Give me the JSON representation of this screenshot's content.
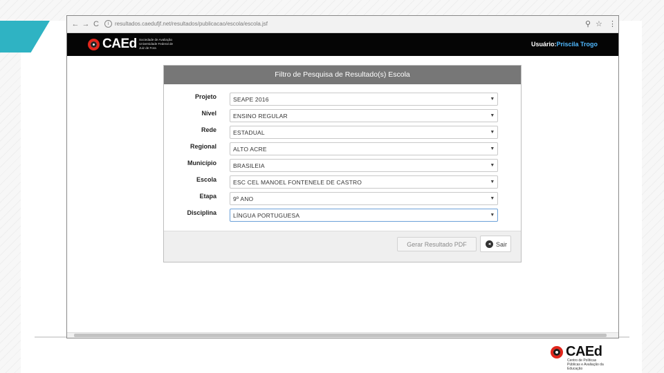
{
  "browser": {
    "url": "resultados.caedufjf.net/resultados/publicacao/escola/escola.jsf",
    "nav_back": "←",
    "nav_forward": "→",
    "nav_reload": "C",
    "info_glyph": "i",
    "zoom_glyph": "⚲",
    "star_glyph": "☆",
    "menu_glyph": "⋮"
  },
  "header": {
    "logo_text": "CAEd",
    "logo_subtitle": "Sociedade de Avaliação Universidade Federal de Juiz de Fora",
    "user_label": "Usuário:",
    "user_name": "Priscila Trogo"
  },
  "panel": {
    "title": "Filtro de Pesquisa de Resultado(s) Escola",
    "fields": [
      {
        "label": "Projeto",
        "value": "SEAPE 2016"
      },
      {
        "label": "Nível",
        "value": "ENSINO REGULAR"
      },
      {
        "label": "Rede",
        "value": "ESTADUAL"
      },
      {
        "label": "Regional",
        "value": "ALTO ACRE"
      },
      {
        "label": "Município",
        "value": "BRASILEIA"
      },
      {
        "label": "Escola",
        "value": "ESC CEL MANOEL FONTENELE DE CASTRO"
      },
      {
        "label": "Etapa",
        "value": "9º ANO"
      },
      {
        "label": "Disciplina",
        "value": "LÍNGUA PORTUGUESA"
      }
    ],
    "select_arrow": "▼",
    "generate_button": "Gerar Resultado PDF",
    "exit_button": "Sair",
    "exit_icon_glyph": "◂"
  },
  "slide": {
    "accent_color": "#2fb3c3",
    "footer_logo_text": "CAEd",
    "footer_logo_subtitle": "Centro de Políticas Públicas e Avaliação da Educação"
  }
}
